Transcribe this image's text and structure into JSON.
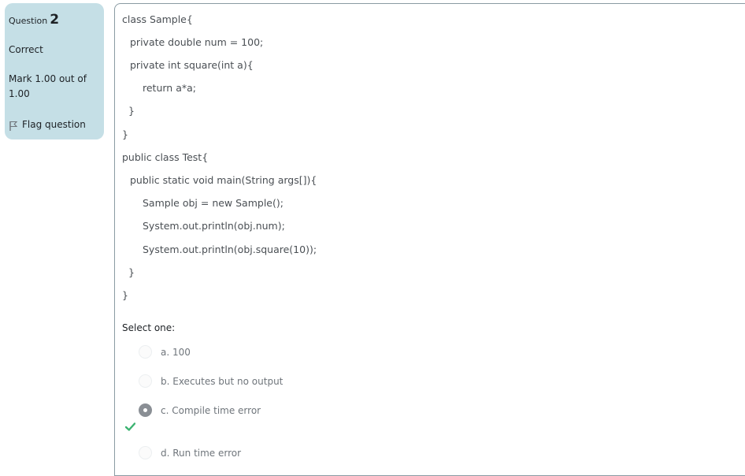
{
  "question_info": {
    "label": "Question",
    "number": "2",
    "state": "Correct",
    "grade": "Mark 1.00 out of 1.00",
    "flag_label": "Flag question"
  },
  "code_lines": [
    "class Sample{",
    "private double num = 100;",
    "private int square(int a){",
    "return a*a;",
    "}",
    "}",
    "public class Test{",
    "public static void main(String args[]){",
    "Sample obj = new Sample();",
    "System.out.println(obj.num);",
    "System.out.println(obj.square(10));",
    "}",
    "}"
  ],
  "prompt": "Select one:",
  "options": [
    {
      "label": "a. 100",
      "selected": false
    },
    {
      "label": "b. Executes but no output",
      "selected": false
    },
    {
      "label": "c. Compile time error",
      "selected": true,
      "correct": true
    },
    {
      "label": "d. Run time error",
      "selected": false
    }
  ],
  "colors": {
    "info_bg": "#c5dfe6",
    "correct_check": "#3cb371",
    "selected_radio": "#8a8f95"
  }
}
